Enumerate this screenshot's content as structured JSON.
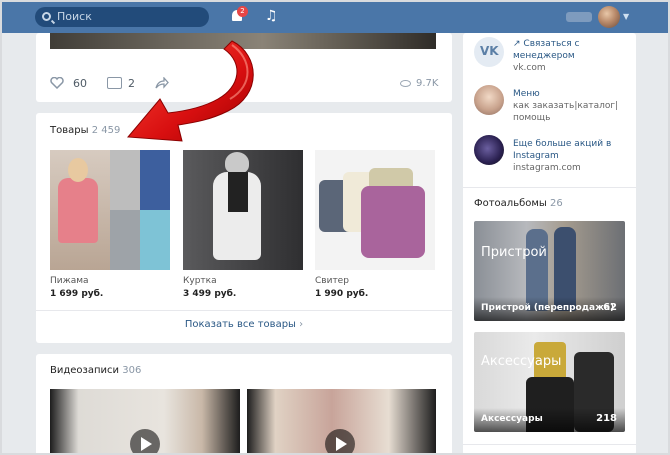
{
  "topbar": {
    "search_placeholder": "Поиск",
    "notifications_count": "2"
  },
  "post": {
    "likes": "60",
    "comments": "2",
    "views": "9.7K"
  },
  "goods": {
    "title": "Товары",
    "count": "2 459",
    "items": [
      {
        "name": "Пижама",
        "price": "1 699 руб."
      },
      {
        "name": "Куртка",
        "price": "3 499 руб."
      },
      {
        "name": "Свитер",
        "price": "1 990 руб."
      }
    ],
    "show_all": "Показать все товары"
  },
  "videos": {
    "title": "Видеозаписи",
    "count": "306"
  },
  "sidebar": {
    "contacts": [
      {
        "title": "Связаться с менеджером",
        "subtitle": "vk.com"
      },
      {
        "title": "Меню",
        "subtitle": "как заказать|каталог|помощь"
      },
      {
        "title": "Еще больше акций в Instagram",
        "subtitle": "instagram.com"
      }
    ],
    "albums_title": "Фотоальбомы",
    "albums_count": "26",
    "albums": [
      {
        "label": "Пристрой",
        "caption": "Пристрой (перепродажа)",
        "count": "62"
      },
      {
        "label": "Аксессуары",
        "caption": "Аксессуары",
        "count": "218"
      }
    ]
  },
  "colors": {
    "header": "#4a76a8",
    "link": "#2a5885",
    "arrow": "#e01818"
  }
}
